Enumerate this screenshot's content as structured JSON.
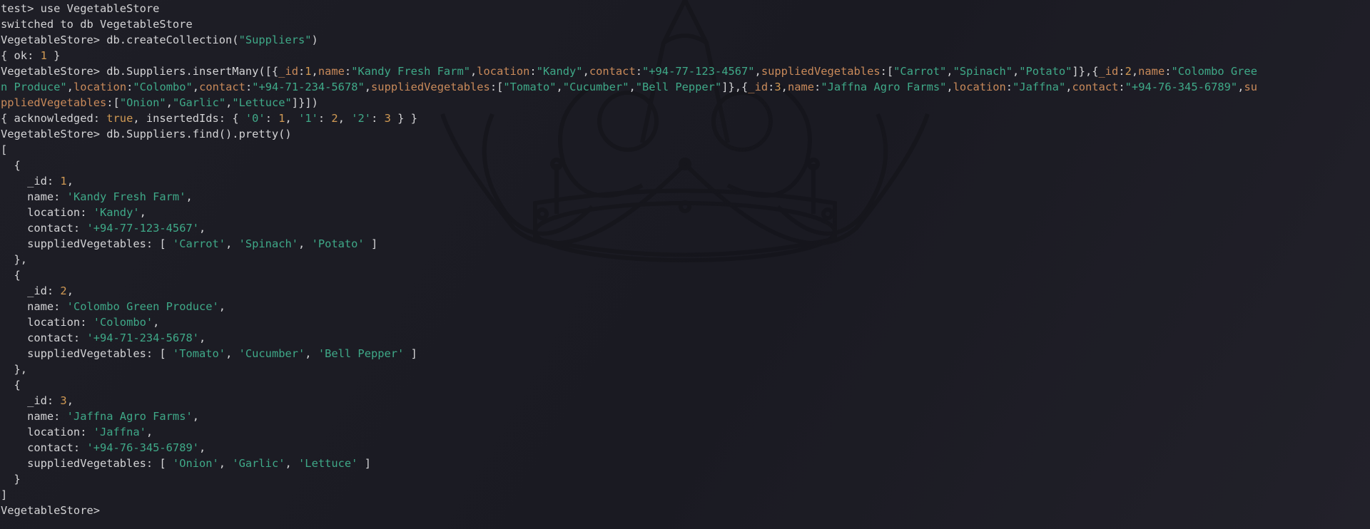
{
  "theme": {
    "background": "#1c1c24",
    "foreground": "#d4d4d6",
    "string_color": "#3fa988",
    "number_color": "#d19a54",
    "key_color": "#c98a5a",
    "wallpaper_icon": "crown-icon"
  },
  "terminal": {
    "lines": [
      [
        {
          "t": "test> use VegetableStore",
          "c": "plain"
        }
      ],
      [
        {
          "t": "switched to db VegetableStore",
          "c": "plain"
        }
      ],
      [
        {
          "t": "VegetableStore> db.createCollection(",
          "c": "plain"
        },
        {
          "t": "\"Suppliers\"",
          "c": "str"
        },
        {
          "t": ")",
          "c": "plain"
        }
      ],
      [
        {
          "t": "{ ok: ",
          "c": "plain"
        },
        {
          "t": "1",
          "c": "num"
        },
        {
          "t": " }",
          "c": "plain"
        }
      ],
      [
        {
          "t": "VegetableStore> db.Suppliers.insertMany([{",
          "c": "plain"
        },
        {
          "t": "_id",
          "c": "key"
        },
        {
          "t": ":",
          "c": "plain"
        },
        {
          "t": "1",
          "c": "num"
        },
        {
          "t": ",",
          "c": "plain"
        },
        {
          "t": "name",
          "c": "key"
        },
        {
          "t": ":",
          "c": "plain"
        },
        {
          "t": "\"Kandy Fresh Farm\"",
          "c": "str"
        },
        {
          "t": ",",
          "c": "plain"
        },
        {
          "t": "location",
          "c": "key"
        },
        {
          "t": ":",
          "c": "plain"
        },
        {
          "t": "\"Kandy\"",
          "c": "str"
        },
        {
          "t": ",",
          "c": "plain"
        },
        {
          "t": "contact",
          "c": "key"
        },
        {
          "t": ":",
          "c": "plain"
        },
        {
          "t": "\"+94-77-123-4567\"",
          "c": "str"
        },
        {
          "t": ",",
          "c": "plain"
        },
        {
          "t": "suppliedVegetables",
          "c": "key"
        },
        {
          "t": ":[",
          "c": "plain"
        },
        {
          "t": "\"Carrot\"",
          "c": "str"
        },
        {
          "t": ",",
          "c": "plain"
        },
        {
          "t": "\"Spinach\"",
          "c": "str"
        },
        {
          "t": ",",
          "c": "plain"
        },
        {
          "t": "\"Potato\"",
          "c": "str"
        },
        {
          "t": "]},{",
          "c": "plain"
        },
        {
          "t": "_id",
          "c": "key"
        },
        {
          "t": ":",
          "c": "plain"
        },
        {
          "t": "2",
          "c": "num"
        },
        {
          "t": ",",
          "c": "plain"
        },
        {
          "t": "name",
          "c": "key"
        },
        {
          "t": ":",
          "c": "plain"
        },
        {
          "t": "\"Colombo Gree",
          "c": "str"
        }
      ],
      [
        {
          "t": "n Produce\"",
          "c": "str"
        },
        {
          "t": ",",
          "c": "plain"
        },
        {
          "t": "location",
          "c": "key"
        },
        {
          "t": ":",
          "c": "plain"
        },
        {
          "t": "\"Colombo\"",
          "c": "str"
        },
        {
          "t": ",",
          "c": "plain"
        },
        {
          "t": "contact",
          "c": "key"
        },
        {
          "t": ":",
          "c": "plain"
        },
        {
          "t": "\"+94-71-234-5678\"",
          "c": "str"
        },
        {
          "t": ",",
          "c": "plain"
        },
        {
          "t": "suppliedVegetables",
          "c": "key"
        },
        {
          "t": ":[",
          "c": "plain"
        },
        {
          "t": "\"Tomato\"",
          "c": "str"
        },
        {
          "t": ",",
          "c": "plain"
        },
        {
          "t": "\"Cucumber\"",
          "c": "str"
        },
        {
          "t": ",",
          "c": "plain"
        },
        {
          "t": "\"Bell Pepper\"",
          "c": "str"
        },
        {
          "t": "]},{",
          "c": "plain"
        },
        {
          "t": "_id",
          "c": "key"
        },
        {
          "t": ":",
          "c": "plain"
        },
        {
          "t": "3",
          "c": "num"
        },
        {
          "t": ",",
          "c": "plain"
        },
        {
          "t": "name",
          "c": "key"
        },
        {
          "t": ":",
          "c": "plain"
        },
        {
          "t": "\"Jaffna Agro Farms\"",
          "c": "str"
        },
        {
          "t": ",",
          "c": "plain"
        },
        {
          "t": "location",
          "c": "key"
        },
        {
          "t": ":",
          "c": "plain"
        },
        {
          "t": "\"Jaffna\"",
          "c": "str"
        },
        {
          "t": ",",
          "c": "plain"
        },
        {
          "t": "contact",
          "c": "key"
        },
        {
          "t": ":",
          "c": "plain"
        },
        {
          "t": "\"+94-76-345-6789\"",
          "c": "str"
        },
        {
          "t": ",",
          "c": "plain"
        },
        {
          "t": "su",
          "c": "key"
        }
      ],
      [
        {
          "t": "ppliedVegetables",
          "c": "key"
        },
        {
          "t": ":[",
          "c": "plain"
        },
        {
          "t": "\"Onion\"",
          "c": "str"
        },
        {
          "t": ",",
          "c": "plain"
        },
        {
          "t": "\"Garlic\"",
          "c": "str"
        },
        {
          "t": ",",
          "c": "plain"
        },
        {
          "t": "\"Lettuce\"",
          "c": "str"
        },
        {
          "t": "]}])",
          "c": "plain"
        }
      ],
      [
        {
          "t": "{ acknowledged: ",
          "c": "plain"
        },
        {
          "t": "true",
          "c": "num"
        },
        {
          "t": ", insertedIds: { ",
          "c": "plain"
        },
        {
          "t": "'0'",
          "c": "str"
        },
        {
          "t": ": ",
          "c": "plain"
        },
        {
          "t": "1",
          "c": "num"
        },
        {
          "t": ", ",
          "c": "plain"
        },
        {
          "t": "'1'",
          "c": "str"
        },
        {
          "t": ": ",
          "c": "plain"
        },
        {
          "t": "2",
          "c": "num"
        },
        {
          "t": ", ",
          "c": "plain"
        },
        {
          "t": "'2'",
          "c": "str"
        },
        {
          "t": ": ",
          "c": "plain"
        },
        {
          "t": "3",
          "c": "num"
        },
        {
          "t": " } }",
          "c": "plain"
        }
      ],
      [
        {
          "t": "VegetableStore> db.Suppliers.find().pretty()",
          "c": "plain"
        }
      ],
      [
        {
          "t": "[",
          "c": "plain"
        }
      ],
      [
        {
          "t": "  {",
          "c": "plain"
        }
      ],
      [
        {
          "t": "    _id: ",
          "c": "plain"
        },
        {
          "t": "1",
          "c": "num"
        },
        {
          "t": ",",
          "c": "plain"
        }
      ],
      [
        {
          "t": "    name: ",
          "c": "plain"
        },
        {
          "t": "'Kandy Fresh Farm'",
          "c": "str"
        },
        {
          "t": ",",
          "c": "plain"
        }
      ],
      [
        {
          "t": "    location: ",
          "c": "plain"
        },
        {
          "t": "'Kandy'",
          "c": "str"
        },
        {
          "t": ",",
          "c": "plain"
        }
      ],
      [
        {
          "t": "    contact: ",
          "c": "plain"
        },
        {
          "t": "'+94-77-123-4567'",
          "c": "str"
        },
        {
          "t": ",",
          "c": "plain"
        }
      ],
      [
        {
          "t": "    suppliedVegetables: [ ",
          "c": "plain"
        },
        {
          "t": "'Carrot'",
          "c": "str"
        },
        {
          "t": ", ",
          "c": "plain"
        },
        {
          "t": "'Spinach'",
          "c": "str"
        },
        {
          "t": ", ",
          "c": "plain"
        },
        {
          "t": "'Potato'",
          "c": "str"
        },
        {
          "t": " ]",
          "c": "plain"
        }
      ],
      [
        {
          "t": "  },",
          "c": "plain"
        }
      ],
      [
        {
          "t": "  {",
          "c": "plain"
        }
      ],
      [
        {
          "t": "    _id: ",
          "c": "plain"
        },
        {
          "t": "2",
          "c": "num"
        },
        {
          "t": ",",
          "c": "plain"
        }
      ],
      [
        {
          "t": "    name: ",
          "c": "plain"
        },
        {
          "t": "'Colombo Green Produce'",
          "c": "str"
        },
        {
          "t": ",",
          "c": "plain"
        }
      ],
      [
        {
          "t": "    location: ",
          "c": "plain"
        },
        {
          "t": "'Colombo'",
          "c": "str"
        },
        {
          "t": ",",
          "c": "plain"
        }
      ],
      [
        {
          "t": "    contact: ",
          "c": "plain"
        },
        {
          "t": "'+94-71-234-5678'",
          "c": "str"
        },
        {
          "t": ",",
          "c": "plain"
        }
      ],
      [
        {
          "t": "    suppliedVegetables: [ ",
          "c": "plain"
        },
        {
          "t": "'Tomato'",
          "c": "str"
        },
        {
          "t": ", ",
          "c": "plain"
        },
        {
          "t": "'Cucumber'",
          "c": "str"
        },
        {
          "t": ", ",
          "c": "plain"
        },
        {
          "t": "'Bell Pepper'",
          "c": "str"
        },
        {
          "t": " ]",
          "c": "plain"
        }
      ],
      [
        {
          "t": "  },",
          "c": "plain"
        }
      ],
      [
        {
          "t": "  {",
          "c": "plain"
        }
      ],
      [
        {
          "t": "    _id: ",
          "c": "plain"
        },
        {
          "t": "3",
          "c": "num"
        },
        {
          "t": ",",
          "c": "plain"
        }
      ],
      [
        {
          "t": "    name: ",
          "c": "plain"
        },
        {
          "t": "'Jaffna Agro Farms'",
          "c": "str"
        },
        {
          "t": ",",
          "c": "plain"
        }
      ],
      [
        {
          "t": "    location: ",
          "c": "plain"
        },
        {
          "t": "'Jaffna'",
          "c": "str"
        },
        {
          "t": ",",
          "c": "plain"
        }
      ],
      [
        {
          "t": "    contact: ",
          "c": "plain"
        },
        {
          "t": "'+94-76-345-6789'",
          "c": "str"
        },
        {
          "t": ",",
          "c": "plain"
        }
      ],
      [
        {
          "t": "    suppliedVegetables: [ ",
          "c": "plain"
        },
        {
          "t": "'Onion'",
          "c": "str"
        },
        {
          "t": ", ",
          "c": "plain"
        },
        {
          "t": "'Garlic'",
          "c": "str"
        },
        {
          "t": ", ",
          "c": "plain"
        },
        {
          "t": "'Lettuce'",
          "c": "str"
        },
        {
          "t": " ]",
          "c": "plain"
        }
      ],
      [
        {
          "t": "  }",
          "c": "plain"
        }
      ],
      [
        {
          "t": "]",
          "c": "plain"
        }
      ],
      [
        {
          "t": "VegetableStore> ",
          "c": "plain"
        }
      ]
    ]
  }
}
